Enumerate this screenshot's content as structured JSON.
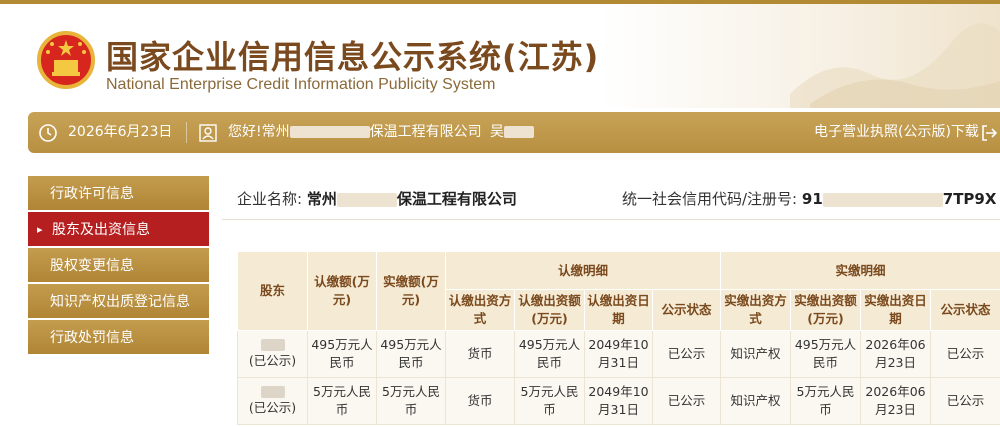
{
  "header": {
    "title_cn": "国家企业信用信息公示系统(江苏)",
    "title_en": "National Enterprise Credit Information Publicity System",
    "emblem": "national-emblem",
    "colors": {
      "title": "#7a4a1e",
      "gold": "#b38a34",
      "active": "#b51f1f"
    }
  },
  "infobar": {
    "date": "2026年6月23日",
    "greeting_prefix": "您好!常州",
    "greeting_suffix": "保温工程有限公司",
    "extra": "吴",
    "download_label": "电子营业执照(公示版)下载",
    "clock_icon": "clock-icon",
    "user_icon": "user-icon",
    "logout_icon": "logout-icon"
  },
  "sidebar": {
    "items": [
      {
        "label": "行政许可信息"
      },
      {
        "label": "股东及出资信息",
        "active": true
      },
      {
        "label": "股权变更信息"
      },
      {
        "label": "知识产权出质登记信息"
      },
      {
        "label": "行政处罚信息"
      }
    ]
  },
  "company": {
    "name_label": "企业名称:",
    "name_prefix": "常州",
    "name_suffix": "保温工程有限公司",
    "credit_label": "统一社会信用代码/注册号:",
    "credit_prefix": "91",
    "credit_suffix": "7TP9X"
  },
  "table": {
    "group_headers": {
      "shareholder": "股东",
      "subscribed": "认缴额(万元)",
      "paid": "实缴额(万元)",
      "sub_detail": "认缴明细",
      "paid_detail": "实缴明细"
    },
    "sub_headers": [
      "认缴出资方式",
      "认缴出资额(万元)",
      "认缴出资日期",
      "公示状态",
      "实缴出资方式",
      "实缴出资额(万元)",
      "实缴出资日期",
      "公示状态"
    ],
    "rows": [
      {
        "status_note": "(已公示)",
        "subscribed": "495万元人民币",
        "paid": "495万元人民币",
        "sub_method": "货币",
        "sub_amount": "495万元人民币",
        "sub_date": "2049年10月31日",
        "sub_status": "已公示",
        "paid_method": "知识产权",
        "paid_amount": "495万元人民币",
        "paid_date": "2026年06月23日",
        "paid_status": "已公示"
      },
      {
        "status_note": "(已公示)",
        "subscribed": "5万元人民币",
        "paid": "5万元人民币",
        "sub_method": "货币",
        "sub_amount": "5万元人民币",
        "sub_date": "2049年10月31日",
        "sub_status": "已公示",
        "paid_method": "知识产权",
        "paid_amount": "5万元人民币",
        "paid_date": "2026年06月23日",
        "paid_status": "已公示"
      }
    ]
  }
}
